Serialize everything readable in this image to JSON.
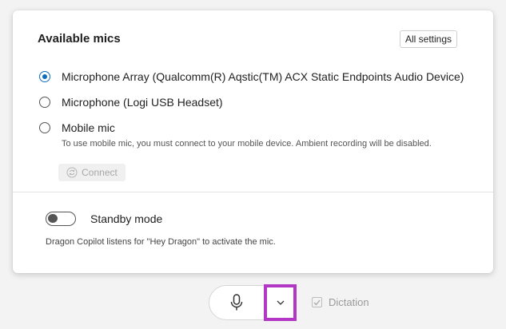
{
  "panel": {
    "title": "Available mics",
    "all_settings_label": "All settings",
    "mics": [
      {
        "label": "Microphone Array (Qualcomm(R) Aqstic(TM) ACX Static Endpoints Audio Device)",
        "selected": true
      },
      {
        "label": "Microphone (Logi USB Headset)",
        "selected": false
      },
      {
        "label": "Mobile mic",
        "selected": false
      }
    ],
    "mobile_note": "To use mobile mic, you must connect to your mobile device. Ambient recording will be disabled.",
    "connect_label": "Connect",
    "standby": {
      "label": "Standby mode",
      "enabled": false,
      "description": "Dragon Copilot listens for \"Hey Dragon\" to activate the mic."
    }
  },
  "footer": {
    "dictation_label": "Dictation",
    "dictation_checked": true
  },
  "colors": {
    "accent": "#0f6cbd",
    "highlight_border": "#b237c4"
  },
  "icons": {
    "microphone": "microphone-icon",
    "chevron": "chevron-down-icon",
    "connect": "refresh-icon",
    "checkbox": "checkmark-icon"
  }
}
